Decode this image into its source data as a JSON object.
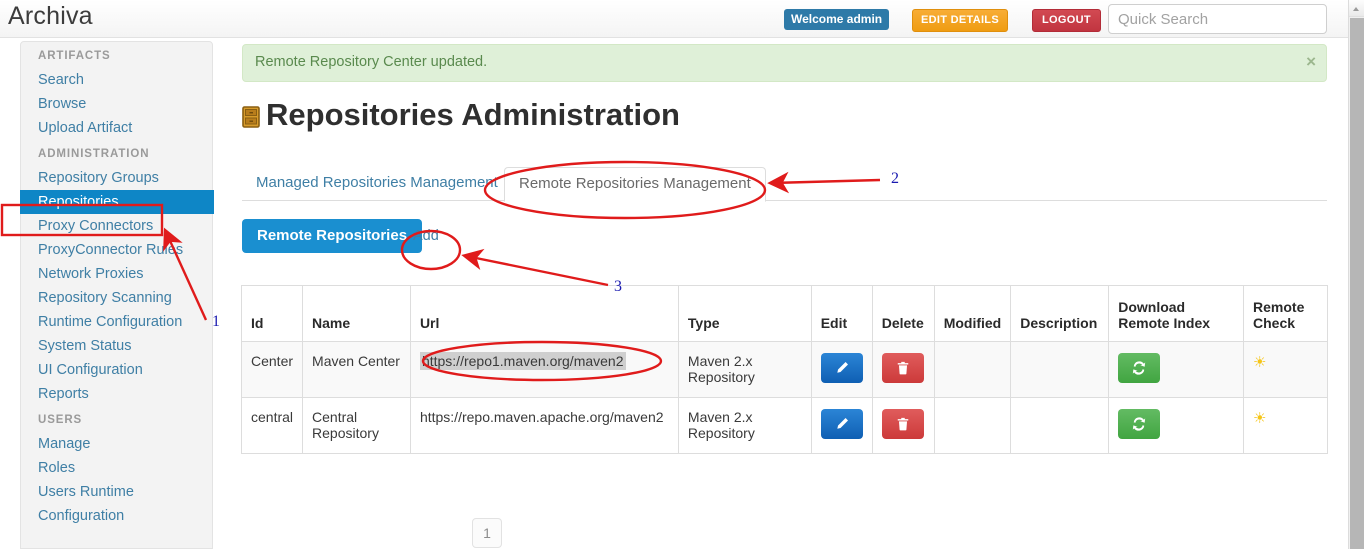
{
  "header": {
    "brand": "Archiva",
    "welcome": "Welcome admin",
    "edit_details": "EDIT DETAILS",
    "logout": "LOGOUT",
    "search_placeholder": "Quick Search",
    "search_value": ""
  },
  "sidebar": {
    "groups": [
      {
        "heading": "ARTIFACTS",
        "items": [
          {
            "label": "Search",
            "active": false
          },
          {
            "label": "Browse",
            "active": false
          },
          {
            "label": "Upload Artifact",
            "active": false
          }
        ]
      },
      {
        "heading": "ADMINISTRATION",
        "items": [
          {
            "label": "Repository Groups",
            "active": false
          },
          {
            "label": "Repositories",
            "active": true
          },
          {
            "label": "Proxy Connectors",
            "active": false
          },
          {
            "label": "ProxyConnector Rules",
            "active": false
          },
          {
            "label": "Network Proxies",
            "active": false
          },
          {
            "label": "Repository Scanning",
            "active": false
          },
          {
            "label": "Runtime Configuration",
            "active": false
          },
          {
            "label": "System Status",
            "active": false
          },
          {
            "label": "UI Configuration",
            "active": false
          },
          {
            "label": "Reports",
            "active": false
          }
        ]
      },
      {
        "heading": "USERS",
        "items": [
          {
            "label": "Manage",
            "active": false
          },
          {
            "label": "Roles",
            "active": false
          },
          {
            "label": "Users Runtime",
            "active": false
          },
          {
            "label": "Configuration",
            "active": false
          }
        ]
      }
    ]
  },
  "main": {
    "alert": {
      "message": "Remote Repository Center updated.",
      "close": "×"
    },
    "title": "Repositories Administration",
    "title_icon": "filing-cabinet-icon",
    "tabs": [
      {
        "label": "Managed Repositories Management",
        "active": false
      },
      {
        "label": "Remote Repositories Management",
        "active": true
      }
    ],
    "toolbar": {
      "heading_button": "Remote Repositories",
      "add_link": "Add"
    },
    "table": {
      "columns": [
        "Id",
        "Name",
        "Url",
        "Type",
        "Edit",
        "Delete",
        "Modified",
        "Description",
        "Download Remote Index",
        "Remote Check"
      ],
      "rows": [
        {
          "id": "Center",
          "name": "Maven Center",
          "url": "https://repo1.maven.org/maven2",
          "url_selected": true,
          "type": "Maven 2.x Repository",
          "modified": "",
          "description": "",
          "edit_icon": "pencil-icon",
          "delete_icon": "trash-icon",
          "download_icon": "refresh-icon",
          "check_icon": "sun-icon"
        },
        {
          "id": "central",
          "name": "Central Repository",
          "url": "https://repo.maven.apache.org/maven2",
          "url_selected": false,
          "type": "Maven 2.x Repository",
          "modified": "",
          "description": "",
          "edit_icon": "pencil-icon",
          "delete_icon": "trash-icon",
          "download_icon": "refresh-icon",
          "check_icon": "sun-icon"
        }
      ]
    },
    "pagination": {
      "current": "1"
    }
  },
  "annotations": {
    "marker_1": "1",
    "marker_2": "2",
    "marker_3": "3",
    "color": "#e01b1b"
  }
}
